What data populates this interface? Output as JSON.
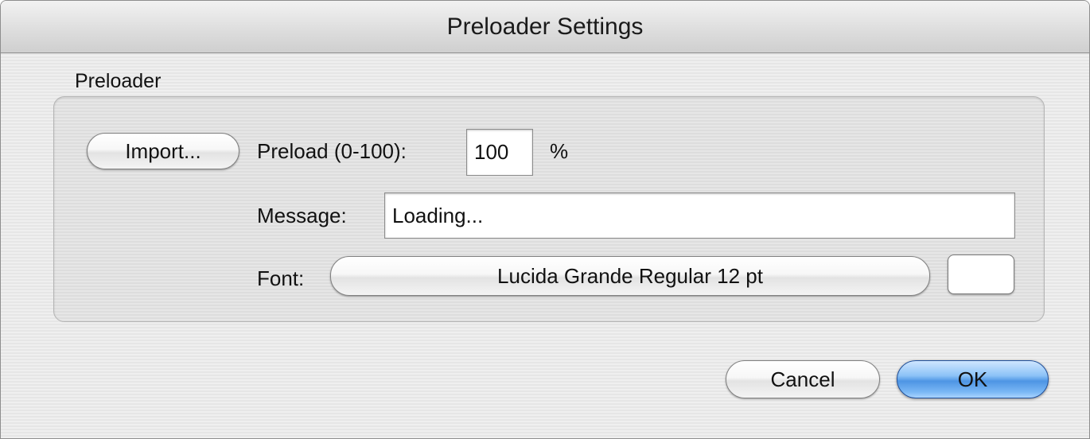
{
  "window": {
    "title": "Preloader Settings"
  },
  "group": {
    "label": "Preloader",
    "import_label": "Import...",
    "preload_label": "Preload (0-100):",
    "preload_value": "100",
    "percent_label": "%",
    "message_label": "Message:",
    "message_value": "Loading...",
    "font_label": "Font:",
    "font_value": "Lucida Grande Regular 12 pt",
    "font_color": "#ffffff"
  },
  "buttons": {
    "cancel_label": "Cancel",
    "ok_label": "OK"
  },
  "colors": {
    "default_button": "#5a9fe8",
    "window_bg": "#ececec"
  }
}
